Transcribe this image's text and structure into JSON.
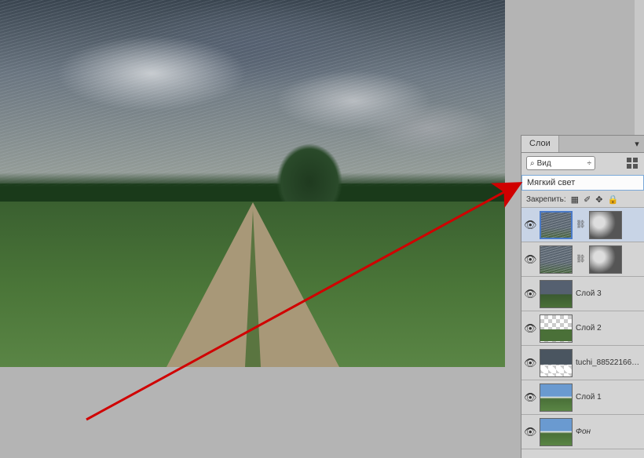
{
  "panel": {
    "tab_label": "Слои",
    "search_label": "Вид",
    "blend_mode": "Мягкий свет",
    "lock_label": "Закрепить:"
  },
  "layers": [
    {
      "name": "",
      "has_mask": true,
      "selected": true,
      "thumb": "rain",
      "mask": "clouds"
    },
    {
      "name": "",
      "has_mask": true,
      "selected": false,
      "thumb": "rain",
      "mask": "clouds"
    },
    {
      "name": "Слой 3",
      "has_mask": false,
      "selected": false,
      "thumb": "storm"
    },
    {
      "name": "Слой 2",
      "has_mask": false,
      "selected": false,
      "thumb": "trans"
    },
    {
      "name": "tuchi_88522166…",
      "has_mask": false,
      "selected": false,
      "thumb": "tuchi"
    },
    {
      "name": "Слой 1",
      "has_mask": false,
      "selected": false,
      "thumb": "clear"
    },
    {
      "name": "Фон",
      "has_mask": false,
      "selected": false,
      "thumb": "clear",
      "italic": true
    }
  ]
}
